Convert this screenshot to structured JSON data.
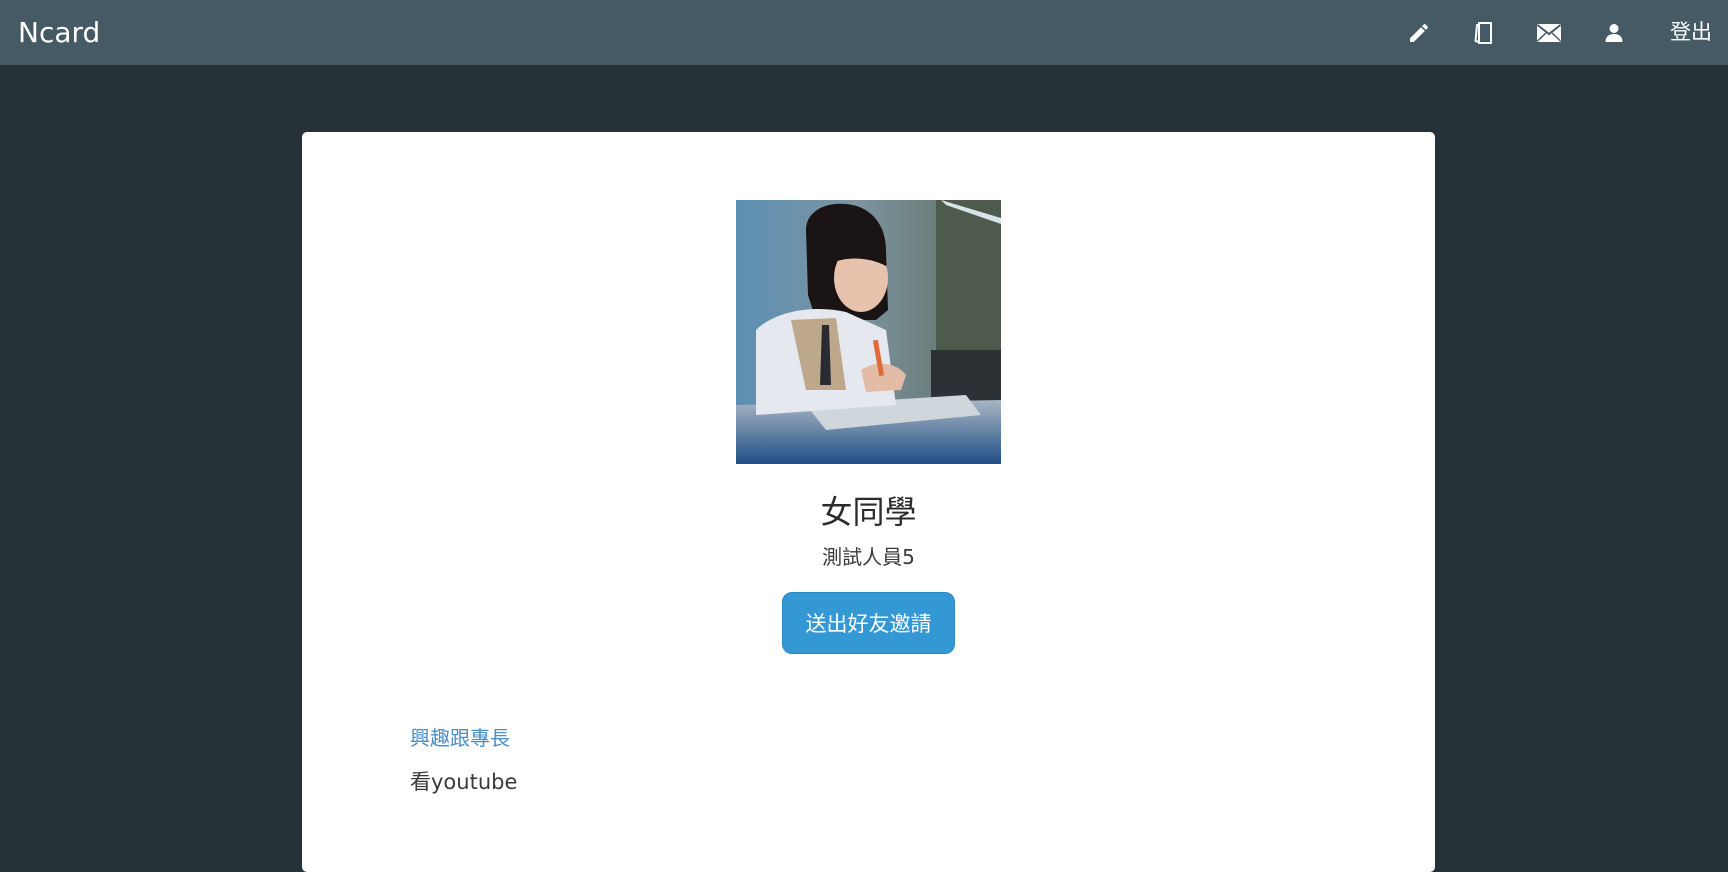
{
  "navbar": {
    "brand": "Ncard",
    "icons": [
      "pencil-icon",
      "cards-icon",
      "mail-icon",
      "user-icon"
    ],
    "logout_label": "登出"
  },
  "profile": {
    "name": "女同學",
    "nickname": "測試人員5",
    "invite_button_label": "送出好友邀請"
  },
  "section": {
    "title": "興趣跟專長",
    "body": "看youtube"
  },
  "colors": {
    "page_background": "#263238",
    "navbar_background": "#455a64",
    "button_primary": "#3498d4",
    "section_title": "#4a90c8"
  }
}
